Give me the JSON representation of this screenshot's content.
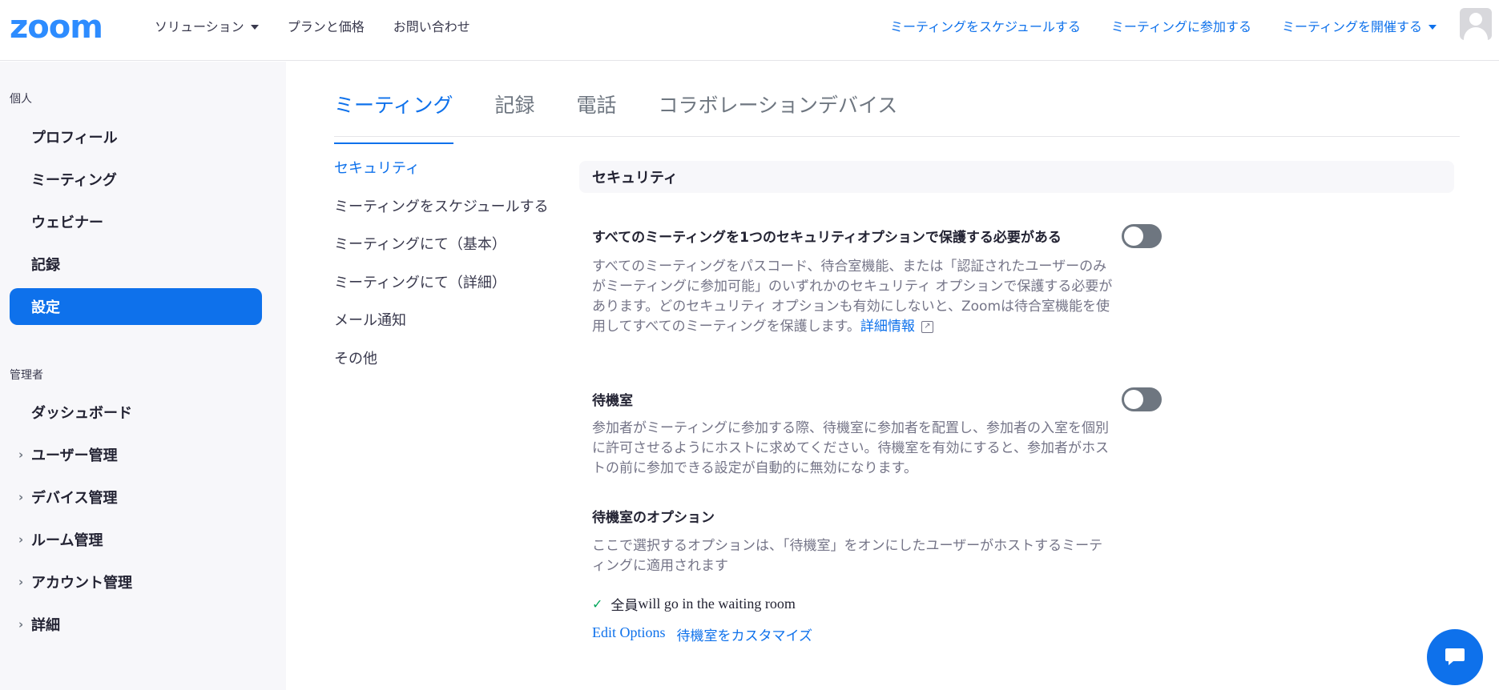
{
  "header": {
    "logo": "zoom",
    "nav_left": [
      {
        "label": "ソリューション",
        "has_caret": true
      },
      {
        "label": "プランと価格",
        "has_caret": false
      },
      {
        "label": "お問い合わせ",
        "has_caret": false
      }
    ],
    "nav_right": [
      {
        "label": "ミーティングをスケジュールする",
        "has_caret": false
      },
      {
        "label": "ミーティングに参加する",
        "has_caret": false
      },
      {
        "label": "ミーティングを開催する",
        "has_caret": true
      }
    ]
  },
  "sidebar": {
    "personal_label": "個人",
    "personal_items": [
      {
        "label": "プロフィール"
      },
      {
        "label": "ミーティング"
      },
      {
        "label": "ウェビナー"
      },
      {
        "label": "記録"
      },
      {
        "label": "設定",
        "active": true
      }
    ],
    "admin_label": "管理者",
    "admin_items": [
      {
        "label": "ダッシュボード",
        "expandable": false
      },
      {
        "label": "ユーザー管理",
        "expandable": true
      },
      {
        "label": "デバイス管理",
        "expandable": true
      },
      {
        "label": "ルーム管理",
        "expandable": true
      },
      {
        "label": "アカウント管理",
        "expandable": true
      },
      {
        "label": "詳細",
        "expandable": true
      }
    ]
  },
  "tabs": [
    {
      "label": "ミーティング",
      "active": true
    },
    {
      "label": "記録"
    },
    {
      "label": "電話"
    },
    {
      "label": "コラボレーションデバイス"
    }
  ],
  "subnav": [
    {
      "label": "セキュリティ",
      "active": true
    },
    {
      "label": "ミーティングをスケジュールする"
    },
    {
      "label": "ミーティングにて（基本）"
    },
    {
      "label": "ミーティングにて（詳細）"
    },
    {
      "label": "メール通知"
    },
    {
      "label": "その他"
    }
  ],
  "section": {
    "title": "セキュリティ",
    "settings": [
      {
        "title": "すべてのミーティングを1つのセキュリティオプションで保護する必要がある",
        "description": "すべてのミーティングをパスコード、待合室機能、または「認証されたユーザーのみがミーティングに参加可能」のいずれかのセキュリティ オプションで保護する必要があります。どのセキュリティ オプションも有効にしないと、Zoomは待合室機能を使用してすべてのミーティングを保護します。",
        "link": "詳細情報",
        "enabled": false
      },
      {
        "title": "待機室",
        "description": "参加者がミーティングに参加する際、待機室に参加者を配置し、参加者の入室を個別に許可させるようにホストに求めてください。待機室を有効にすると、参加者がホストの前に参加できる設定が自動的に無効になります。",
        "enabled": false
      }
    ],
    "waiting_room_options": {
      "title": "待機室のオプション",
      "description": "ここで選択するオプションは、「待機室」をオンにしたユーザーがホストするミーティングに適用されます",
      "selected_prefix": "全員",
      "selected_suffix": " will go in the waiting room",
      "edit_link": "Edit Options",
      "customize_link": "待機室をカスタマイズ"
    }
  },
  "colors": {
    "accent": "#0e71eb",
    "logo": "#2d8cff",
    "sidebar_bg": "#f7f7fa",
    "toggle_off": "#6e7680"
  },
  "icons": {
    "external_link": "external-link-icon",
    "check": "check-icon",
    "chat": "chat-bubble-icon",
    "avatar": "user-avatar-icon"
  }
}
